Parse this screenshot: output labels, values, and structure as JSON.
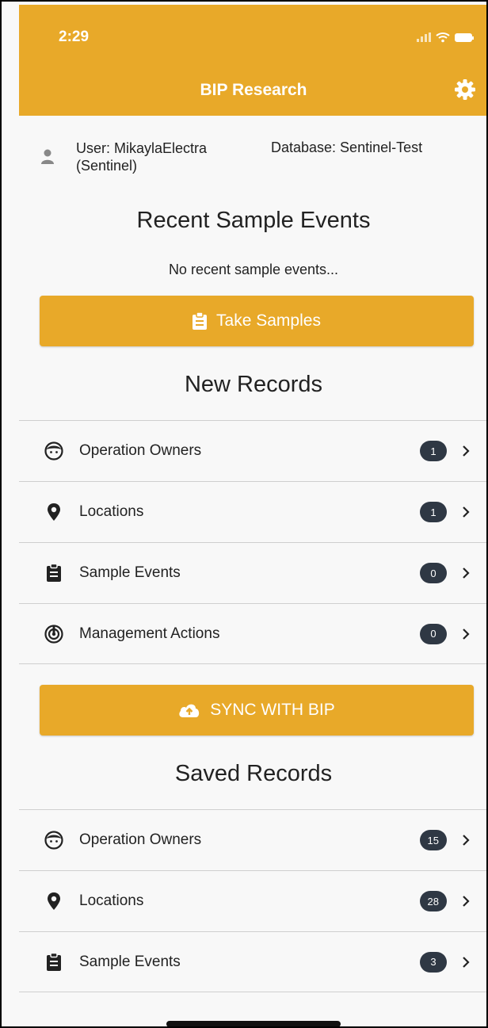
{
  "status": {
    "time": "2:29"
  },
  "header": {
    "title": "BIP Research",
    "settings_icon": "gear-icon"
  },
  "user": {
    "line1": "User: MikaylaElectra",
    "line2": "(Sentinel)",
    "database": "Database: Sentinel-Test"
  },
  "recent": {
    "title": "Recent Sample Events",
    "empty": "No recent sample events..."
  },
  "take_samples": {
    "label": "Take Samples",
    "icon": "clipboard-icon"
  },
  "new_records": {
    "title": "New Records",
    "items": [
      {
        "label": "Operation Owners",
        "count": "1",
        "icon": "face-icon"
      },
      {
        "label": "Locations",
        "count": "1",
        "icon": "map-pin-icon"
      },
      {
        "label": "Sample Events",
        "count": "0",
        "icon": "clipboard-icon"
      },
      {
        "label": "Management Actions",
        "count": "0",
        "icon": "management-icon"
      }
    ]
  },
  "sync": {
    "label": "SYNC WITH BIP",
    "icon": "cloud-upload-icon"
  },
  "saved_records": {
    "title": "Saved Records",
    "items": [
      {
        "label": "Operation Owners",
        "count": "15",
        "icon": "face-icon"
      },
      {
        "label": "Locations",
        "count": "28",
        "icon": "map-pin-icon"
      },
      {
        "label": "Sample Events",
        "count": "3",
        "icon": "clipboard-icon"
      }
    ]
  },
  "colors": {
    "accent": "#e8a929",
    "badge": "#2f3844"
  }
}
